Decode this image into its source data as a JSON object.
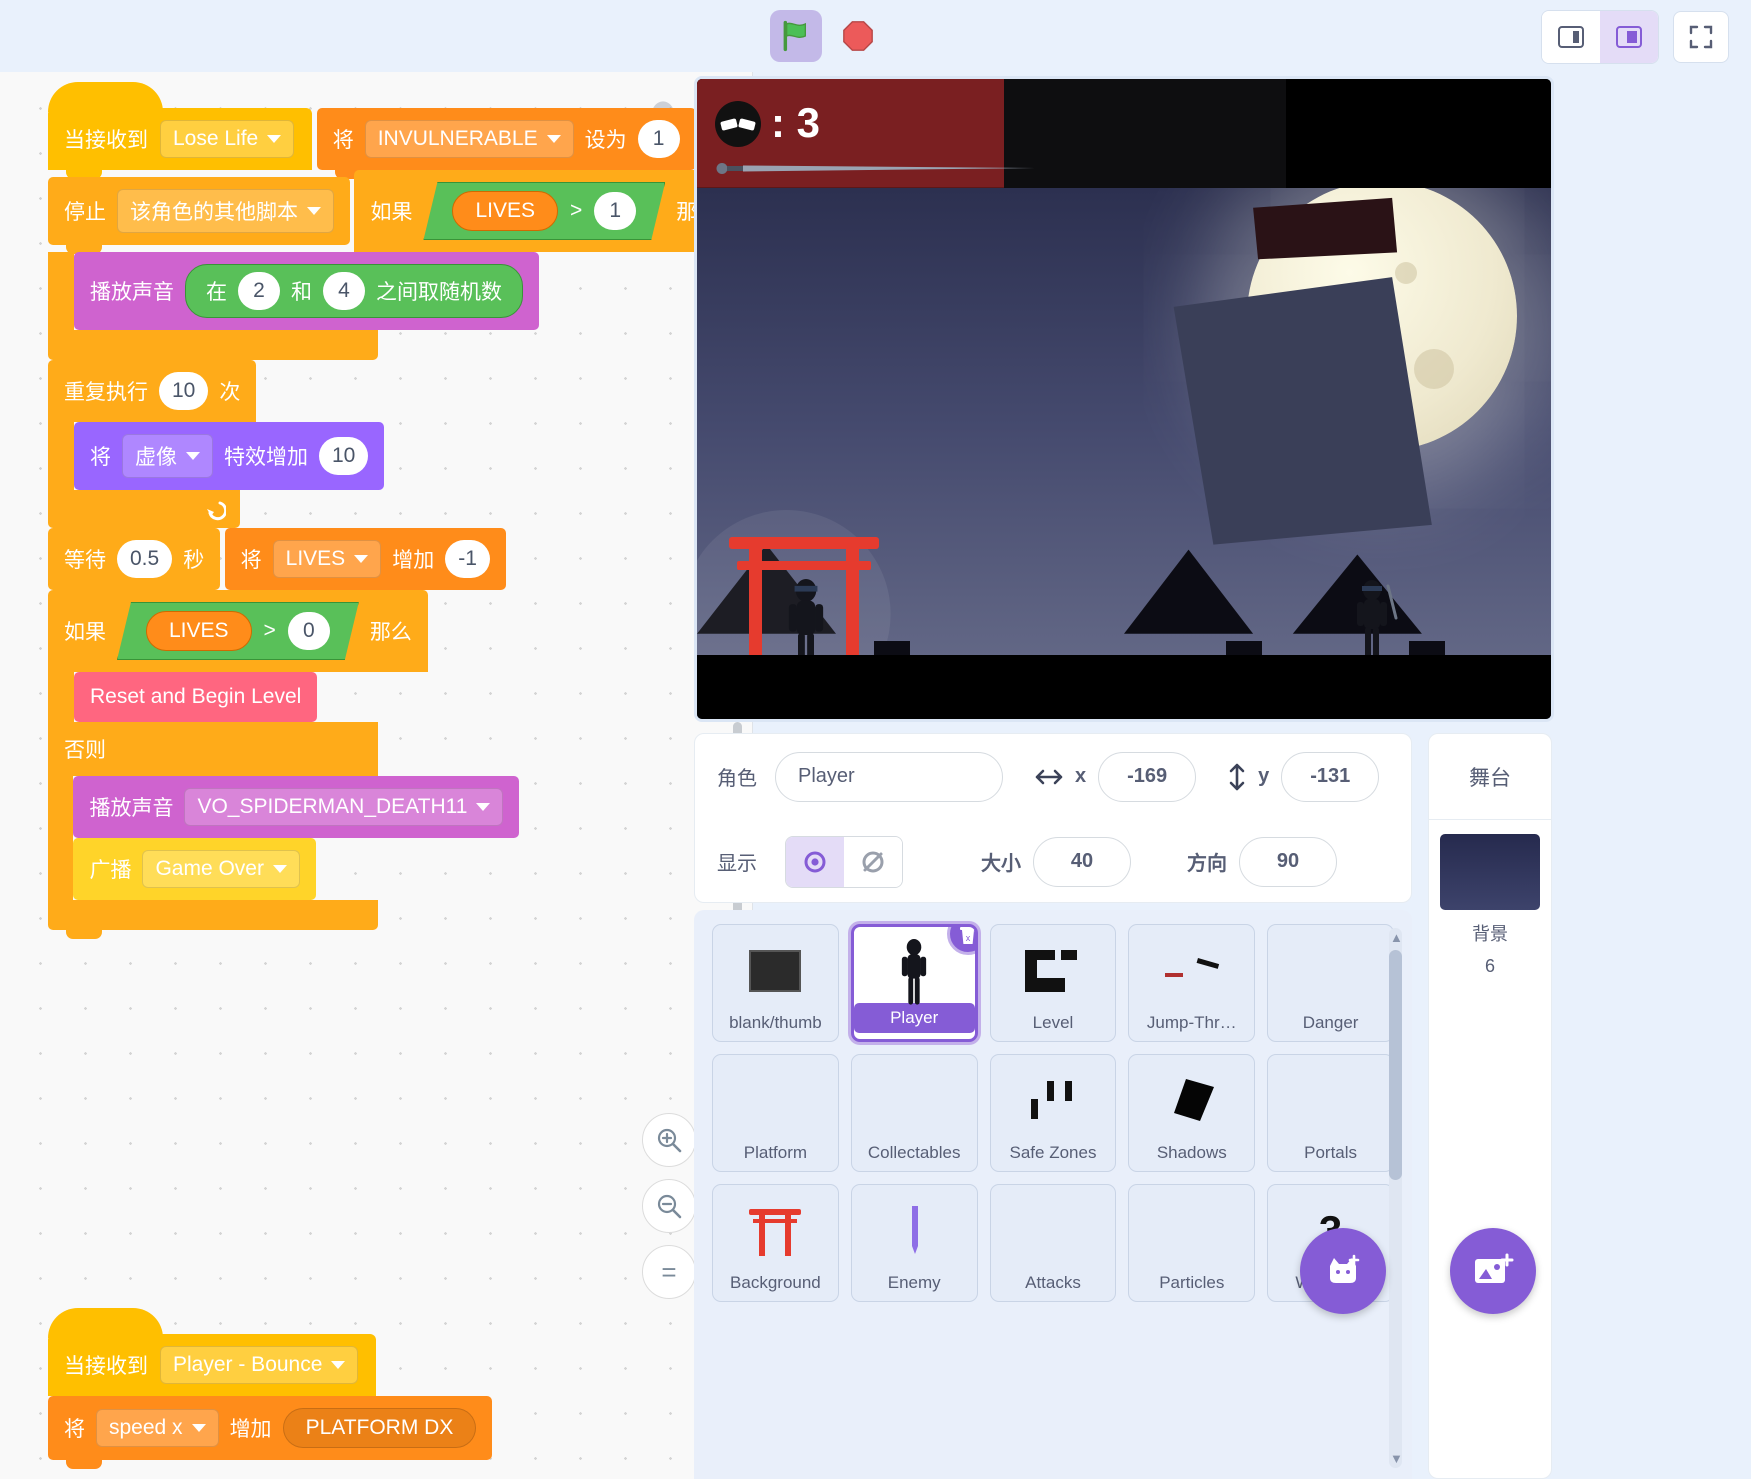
{
  "toolbar": {
    "green_flag_icon": "green-flag-icon",
    "stop_icon": "stop-sign-icon",
    "small_stage_icon": "small-stage-layout-icon",
    "large_stage_icon": "large-stage-layout-icon",
    "fullscreen_icon": "fullscreen-icon"
  },
  "code": {
    "zoom_in_label": "+",
    "zoom_out_label": "−",
    "zoom_reset_label": "=",
    "scripts": [
      {
        "id": "lose-life",
        "hat_label": "当接收到",
        "hat_value": "Lose Life",
        "blocks": [
          {
            "kind": "set-var",
            "label": "将",
            "variable": "INVULNERABLE",
            "mid": "设为",
            "value": "1"
          },
          {
            "kind": "stop",
            "label": "停止",
            "option": "该角色的其他脚本"
          },
          {
            "kind": "if",
            "label": "如果",
            "then": "那么",
            "cond_var": "LIVES",
            "cond_op": ">",
            "cond_val": "1"
          },
          {
            "kind": "play-sound-random",
            "label": "播放声音",
            "rnd_pre": "在",
            "rnd_from": "2",
            "rnd_mid": "和",
            "rnd_to": "4",
            "rnd_post": "之间取随机数"
          },
          {
            "kind": "repeat",
            "label": "重复执行",
            "times": "10",
            "suffix": "次"
          },
          {
            "kind": "change-effect",
            "label": "将",
            "effect": "虚像",
            "mid": "特效增加",
            "value": "10"
          },
          {
            "kind": "wait",
            "label": "等待",
            "value": "0.5",
            "suffix": "秒"
          },
          {
            "kind": "change-var",
            "label": "将",
            "variable": "LIVES",
            "mid": "增加",
            "value": "-1"
          },
          {
            "kind": "if-else",
            "label": "如果",
            "then": "那么",
            "else_label": "否则",
            "cond_var": "LIVES",
            "cond_op": ">",
            "cond_val": "0"
          },
          {
            "kind": "custom",
            "label": "Reset and Begin Level"
          },
          {
            "kind": "play-sound",
            "label": "播放声音",
            "option": "VO_SPIDERMAN_DEATH11"
          },
          {
            "kind": "broadcast",
            "label": "广播",
            "option": "Game Over"
          }
        ]
      },
      {
        "id": "player-bounce",
        "hat_label": "当接收到",
        "hat_value": "Player - Bounce",
        "blocks": [
          {
            "kind": "change-var",
            "label": "将",
            "variable": "speed x",
            "mid": "增加",
            "value": "PLATFORM DX"
          }
        ]
      }
    ]
  },
  "stage": {
    "hud_lives_separator": ":",
    "hud_lives_count": "3"
  },
  "sprite_info": {
    "name_label": "角色",
    "name_value": "Player",
    "x_label": "x",
    "x_value": "-169",
    "y_label": "y",
    "y_value": "-131",
    "show_label": "显示",
    "size_label": "大小",
    "size_value": "40",
    "direction_label": "方向",
    "direction_value": "90",
    "visible_icon": "eye-visible-icon",
    "hidden_icon": "eye-hidden-icon"
  },
  "sprites": [
    {
      "name": "blank/thumb",
      "thumb": "blank-thumb-icon",
      "selected": false
    },
    {
      "name": "Player",
      "thumb": "ninja-player-icon",
      "selected": true
    },
    {
      "name": "Level",
      "thumb": "level-blocks-icon",
      "selected": false
    },
    {
      "name": "Jump-Thr…",
      "thumb": "jump-through-icon",
      "selected": false
    },
    {
      "name": "Danger",
      "thumb": "danger-icon",
      "selected": false
    },
    {
      "name": "Platform",
      "thumb": "platform-icon",
      "selected": false
    },
    {
      "name": "Collectables",
      "thumb": "collectables-icon",
      "selected": false
    },
    {
      "name": "Safe Zones",
      "thumb": "safe-zones-icon",
      "selected": false
    },
    {
      "name": "Shadows",
      "thumb": "shadows-icon",
      "selected": false
    },
    {
      "name": "Portals",
      "thumb": "portals-icon",
      "selected": false
    },
    {
      "name": "Background",
      "thumb": "torii-gate-icon",
      "selected": false
    },
    {
      "name": "Enemy",
      "thumb": "enemy-blade-icon",
      "selected": false
    },
    {
      "name": "Attacks",
      "thumb": "attacks-icon",
      "selected": false
    },
    {
      "name": "Particles",
      "thumb": "particles-icon",
      "selected": false
    },
    {
      "name": "Weapo…",
      "thumb": "weapons-icon",
      "selected": false,
      "overlay_number": "3"
    }
  ],
  "sprite_actions": {
    "delete_icon": "trash-delete-icon",
    "add_sprite_icon": "add-sprite-cat-icon",
    "add_backdrop_icon": "add-backdrop-icon"
  },
  "stage_panel": {
    "title": "舞台",
    "caption": "背景",
    "count": "6"
  },
  "colors": {
    "accent_purple": "#855cd6",
    "events_yellow": "#ffd429",
    "control_orange": "#ffab19",
    "data_orange": "#ff8c1a",
    "sound_magenta": "#cf63cf",
    "looks_purple": "#9966ff",
    "operator_green": "#59c059",
    "custom_pink": "#ff6680"
  }
}
